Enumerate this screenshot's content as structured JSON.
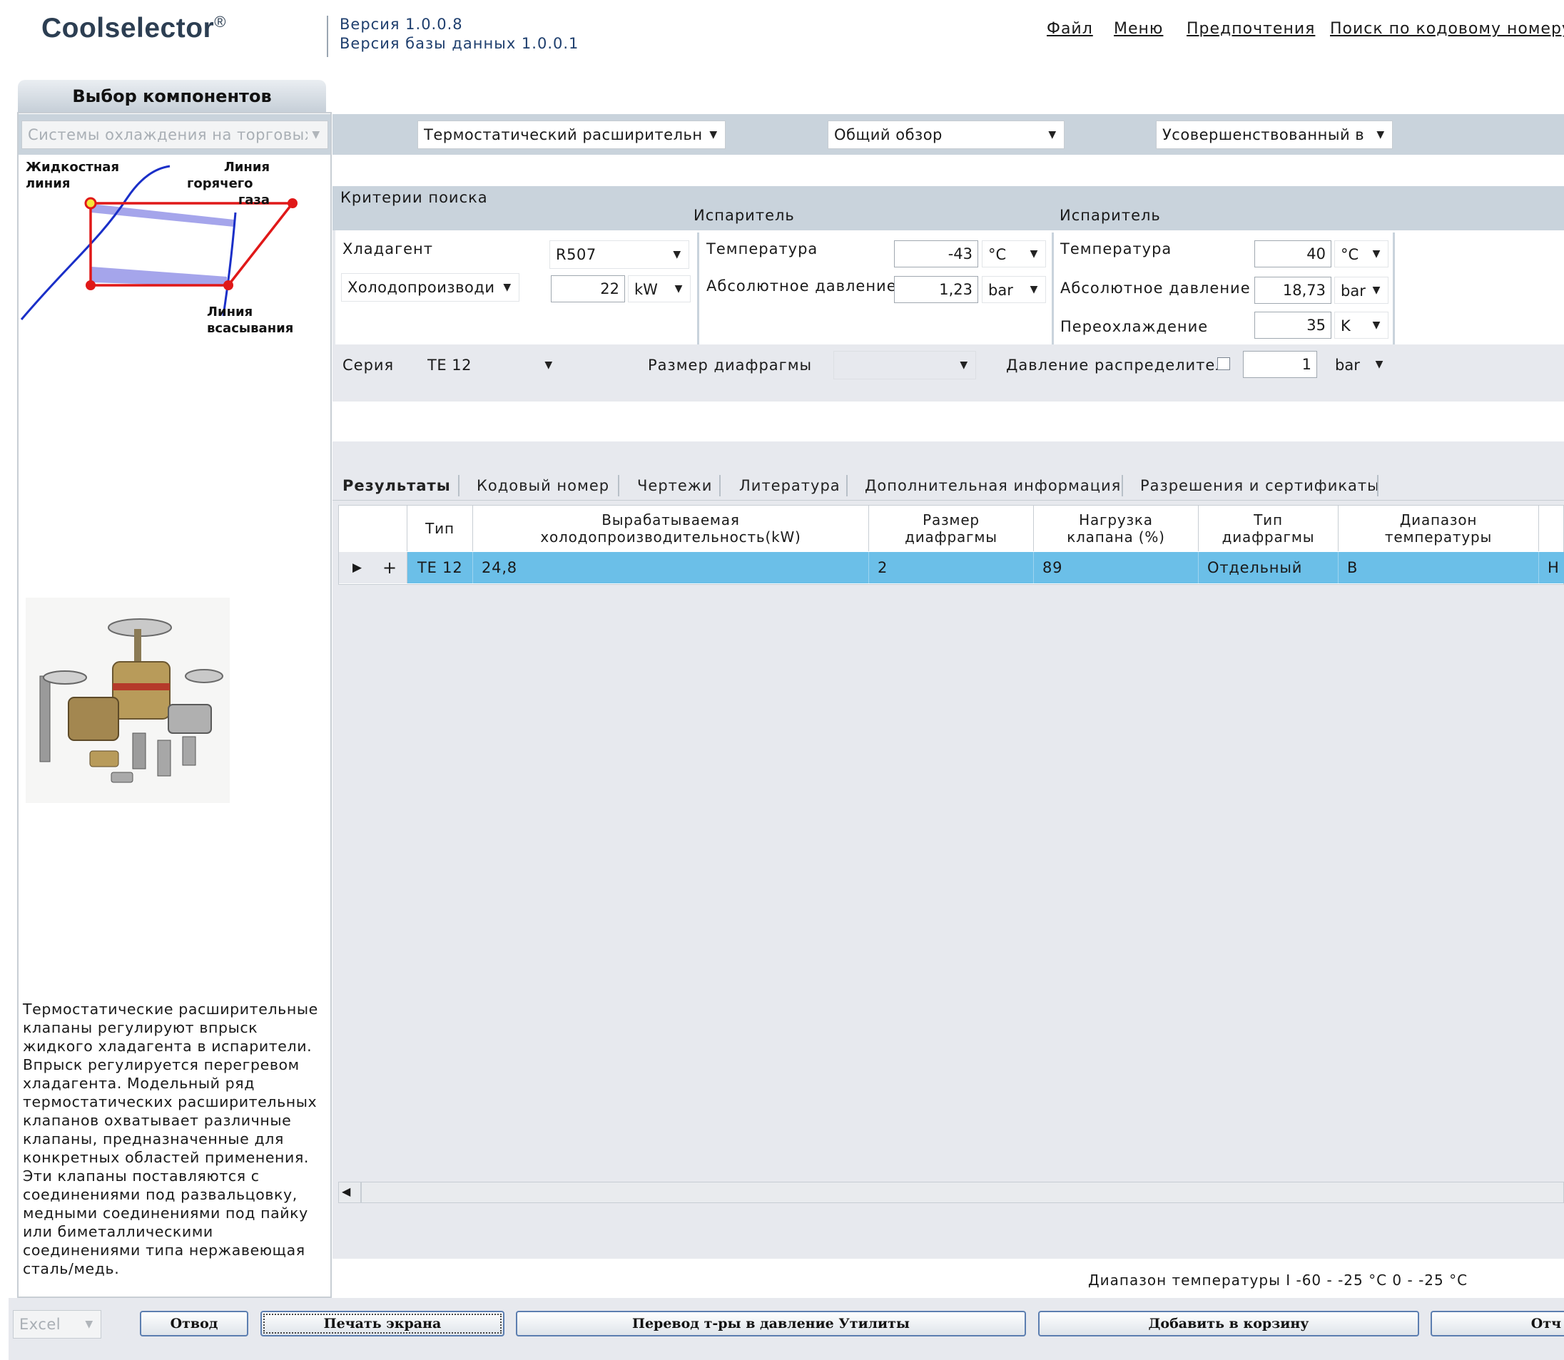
{
  "header": {
    "logo": "Coolselector",
    "logo_mark": "®",
    "version": "Версия 1.0.0.8",
    "db_version": "Версия базы данных 1.0.0.1",
    "links": [
      "Файл",
      "Меню",
      "Предпочтения",
      "Поиск по кодовому номеру"
    ]
  },
  "left": {
    "tab_title": "Выбор компонентов",
    "application_combo": "Системы охлаждения на торговых",
    "diagram": {
      "liquid_line": [
        "Жидкостная",
        "линия"
      ],
      "hot_gas_line": [
        "Линия",
        "горячего",
        "газа"
      ],
      "suction_line": [
        "Линия",
        "всасывания"
      ]
    },
    "description": "Термостатические расширительные клапаны регулируют впрыск жидкого хладагента в испарители. Впрыск регулируется перегревом хладагента. Модельный ряд термостатических расширительных клапанов охватывает различные клапаны, предназначенные для конкретных областей применения. Эти клапаны поставляются с соединениями под развальцовку, медными соединениями под пайку или биметаллическими соединениями типа нержавеющая сталь/медь."
  },
  "topbar": {
    "component_combo": "Термостатический расширительны",
    "view_combo": "Общий обзор",
    "mode_combo": "Усовершенствованный в"
  },
  "criteria": {
    "title": "Критерии поиска",
    "evaporator_header_1": "Испаритель",
    "evaporator_header_2": "Испаритель",
    "refrigerant_label": "Хладагент",
    "refrigerant_value": "R507",
    "capacity_combo": "Холодопроизводи",
    "capacity_value": "22",
    "capacity_unit": "kW",
    "evap_temp_label": "Температура",
    "evap_temp_value": "-43",
    "evap_temp_unit": "°C",
    "evap_pressure_label": "Абсолютное давление",
    "evap_pressure_value": "1,23",
    "evap_pressure_unit": "bar",
    "cond_temp_label": "Температура",
    "cond_temp_value": "40",
    "cond_temp_unit": "°C",
    "cond_pressure_label": "Абсолютное давление",
    "cond_pressure_value": "18,73",
    "cond_pressure_unit": "bar",
    "subcool_label": "Переохлаждение",
    "subcool_value": "35",
    "subcool_unit": "K",
    "series_label": "Серия",
    "series_value": "TE 12",
    "orifice_label": "Размер диафрагмы",
    "orifice_value": "",
    "distributor_label": "Давление распределител",
    "distributor_value": "1",
    "distributor_unit": "bar"
  },
  "tabs": [
    "Результаты",
    "Кодовый номер",
    "Чертежи",
    "Литература",
    "Дополнительная информация",
    "Разрешения и сертификаты"
  ],
  "table": {
    "headers": [
      "Тип",
      "Вырабатываемая холодопроизводительность(kW)",
      "Размер диафрагмы",
      "Нагрузка клапана (%)",
      "Тип диафрагмы",
      "Диапазон температуры",
      "Н"
    ],
    "row": {
      "expand": "▶",
      "plus": "+",
      "type": "TE 12",
      "capacity": "24,8",
      "orifice": "2",
      "load": "89",
      "orifice_type": "Отдельный",
      "range": "B",
      "extra": "Н"
    }
  },
  "status_text": "Диапазон  температуры I -60 - -25 °C 0 - -25 °C",
  "bottom": {
    "export_combo": "Excel",
    "buttons": [
      "Отвод",
      "Печать экрана",
      "Перевод т-ры в давление Утилиты",
      "Добавить в корзину",
      "Отч"
    ]
  }
}
